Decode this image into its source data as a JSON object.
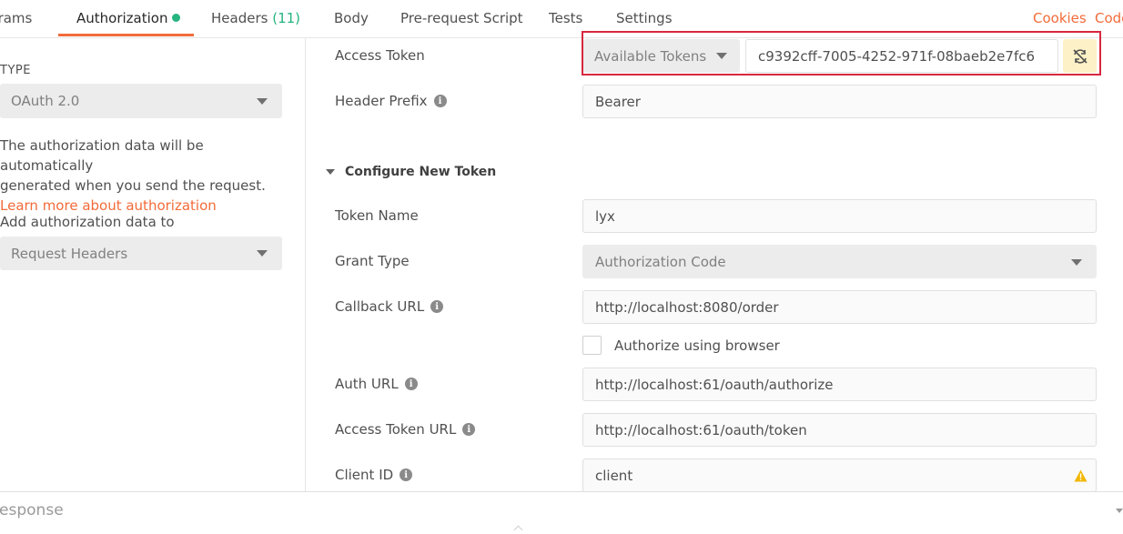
{
  "tabs": {
    "params": "Params",
    "authorization": "Authorization",
    "headers": "Headers",
    "headers_count": "(11)",
    "body": "Body",
    "prerequest": "Pre-request Script",
    "tests": "Tests",
    "settings": "Settings",
    "cookies": "Cookies",
    "code": "Code"
  },
  "left": {
    "type_label": "TYPE",
    "type_value": "OAuth 2.0",
    "description_line1": "The authorization data will be automatically",
    "description_line2": "generated when you send the request.",
    "learn_more": "Learn more about authorization",
    "add_to_label": "Add authorization data to",
    "add_to_value": "Request Headers"
  },
  "current_token": {
    "access_token_label": "Access Token",
    "available_tokens": "Available Tokens",
    "token_value": "c9392cff-7005-4252-971f-08baeb2e7fc6",
    "header_prefix_label": "Header Prefix",
    "header_prefix_value": "Bearer"
  },
  "configure": {
    "section_title": "Configure New Token",
    "token_name_label": "Token Name",
    "token_name_value": "lyx",
    "grant_type_label": "Grant Type",
    "grant_type_value": "Authorization Code",
    "callback_url_label": "Callback URL",
    "callback_url_value": "http://localhost:8080/order",
    "authorize_browser_label": "Authorize using browser",
    "auth_url_label": "Auth URL",
    "auth_url_value": "http://localhost:61/oauth/authorize",
    "access_token_url_label": "Access Token URL",
    "access_token_url_value": "http://localhost:61/oauth/token",
    "client_id_label": "Client ID",
    "client_id_value": "client"
  },
  "response": {
    "label": "Response"
  },
  "colors": {
    "accent": "#f26b3a",
    "green": "#26b47f",
    "highlight": "#d7283e",
    "warning": "#f2b705"
  }
}
